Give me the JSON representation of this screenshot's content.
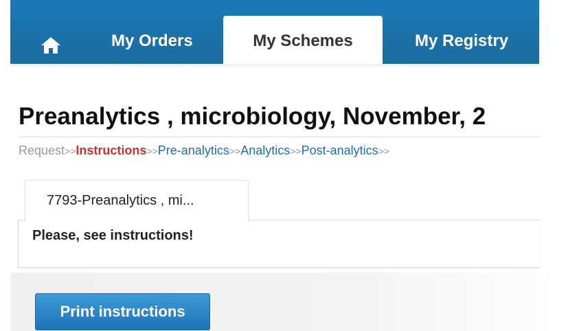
{
  "nav": {
    "home_icon": "home-icon",
    "items": [
      {
        "label": "My Orders"
      },
      {
        "label": "My Schemes"
      },
      {
        "label": "My Registry"
      }
    ],
    "active_index": 1
  },
  "page": {
    "title": "Preanalytics , microbiology, November, 2"
  },
  "breadcrumb": [
    {
      "label": "Request",
      "state": "done"
    },
    {
      "label": "Instructions",
      "state": "active"
    },
    {
      "label": "Pre-analytics",
      "state": "link"
    },
    {
      "label": "Analytics",
      "state": "link"
    },
    {
      "label": "Post-analytics",
      "state": "link"
    }
  ],
  "breadcrumb_separator": ">>",
  "tabs": [
    {
      "label": "7793-Preanalytics , mi..."
    }
  ],
  "panel": {
    "message": "Please, see instructions!"
  },
  "actions": {
    "print_label": "Print instructions"
  },
  "colors": {
    "nav_blue": "#1b77b5",
    "active_step": "#c9302c",
    "link": "#1a6fb3",
    "button": "#2a86c9"
  }
}
